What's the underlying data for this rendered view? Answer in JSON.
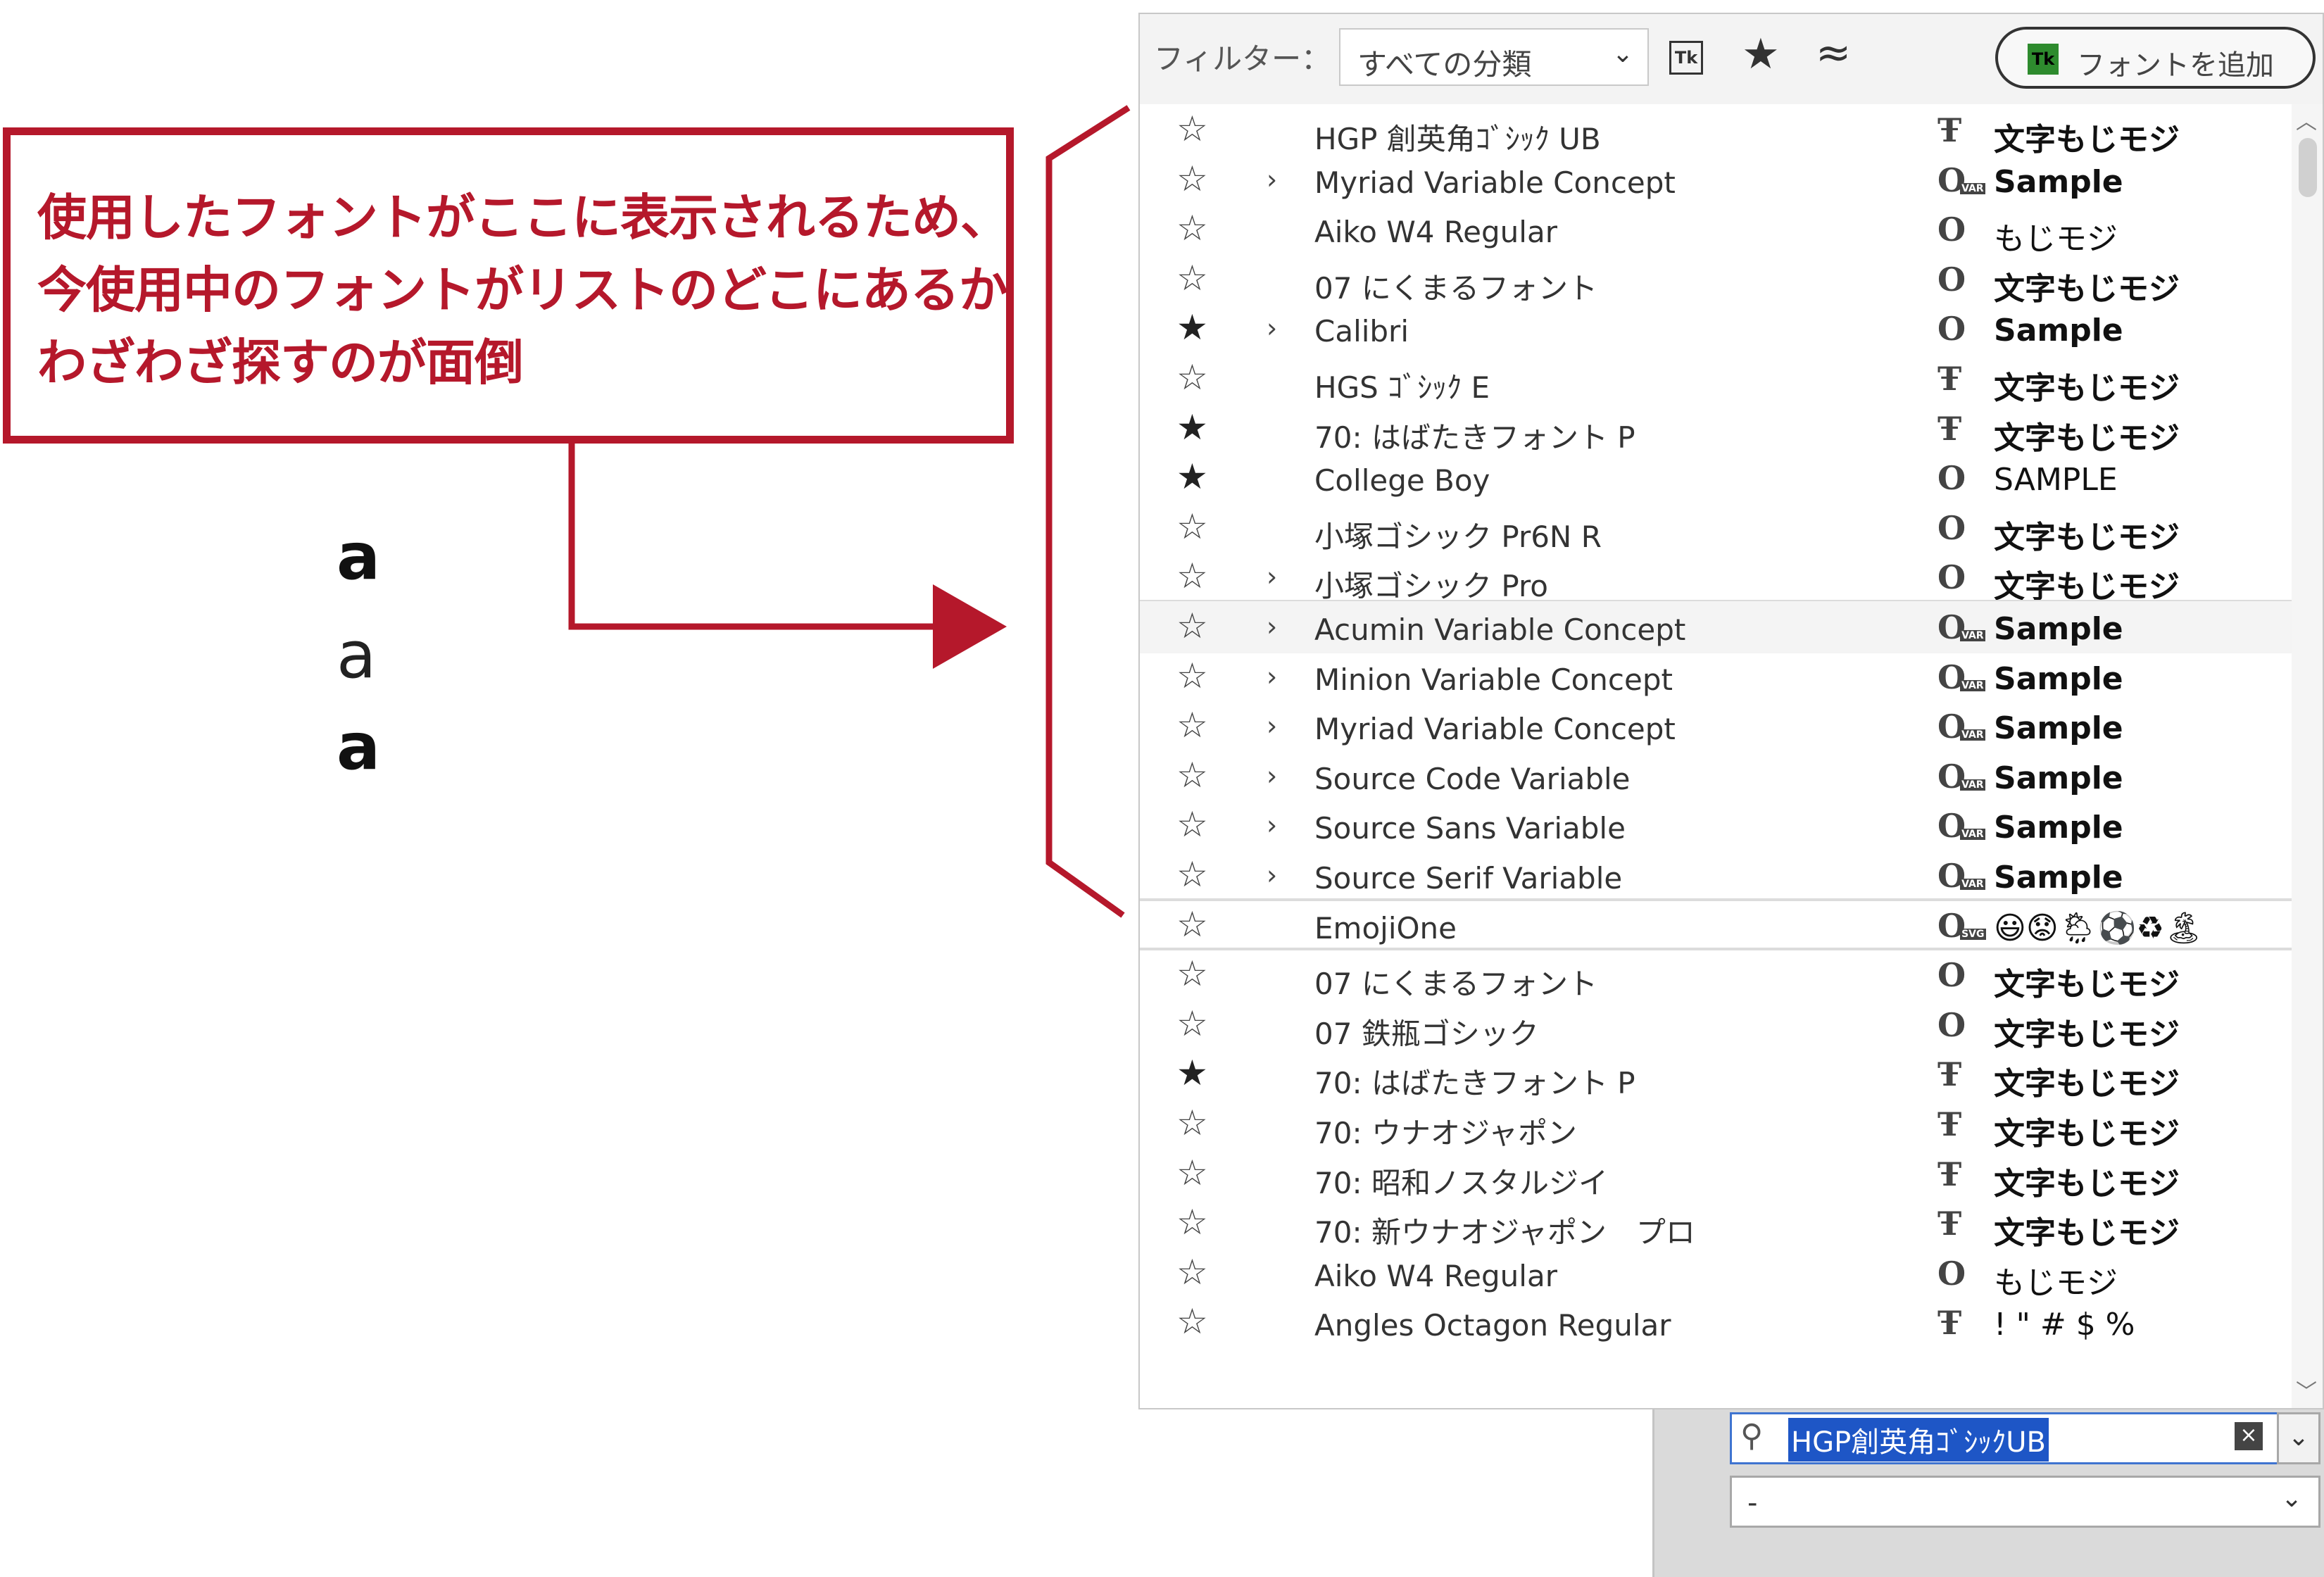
{
  "annotation": {
    "callout_text": "使用したフォントがここに表示されるため、\n今使用中のフォントがリストのどこにあるか\nわざわざ探すのが面倒",
    "glyphs": [
      "a",
      "a",
      "a"
    ],
    "accent_color": "#b5182b"
  },
  "filter_bar": {
    "label": "フィルター：",
    "category_select": "すべての分類",
    "tk_icon": "Tk",
    "favorites_icon": "star-icon",
    "similar_icon": "approx-icon",
    "add_font_label": "フォントを追加",
    "add_font_badge": "Tk"
  },
  "font_list": {
    "recent": [
      {
        "star": "☆",
        "expand": "",
        "name": "HGP 創英角ｺﾞｼｯｸ UB",
        "icon": "Ŧ",
        "sample": "文字もじモジ"
      },
      {
        "star": "☆",
        "expand": "›",
        "name": "Myriad Variable Concept",
        "icon": "O",
        "icon_badge": "var",
        "sample": "Sample"
      },
      {
        "star": "☆",
        "expand": "",
        "name": "Aiko W4 Regular",
        "icon": "O",
        "sample": "もじモジ"
      },
      {
        "star": "☆",
        "expand": "",
        "name": "07 にくまるフォント",
        "icon": "O",
        "sample": "文字もじモジ"
      },
      {
        "star": "★",
        "expand": "›",
        "name": "Calibri",
        "icon": "O",
        "sample": "Sample"
      },
      {
        "star": "☆",
        "expand": "",
        "name": "HGS ｺﾞｼｯｸ E",
        "icon": "Ŧ",
        "sample": "文字もじモジ"
      },
      {
        "star": "★",
        "expand": "",
        "name": "70: はばたきフォント P",
        "icon": "Ŧ",
        "sample": "文字もじモジ"
      },
      {
        "star": "★",
        "expand": "",
        "name": "College Boy",
        "icon": "O",
        "sample": "SAMPLE"
      },
      {
        "star": "☆",
        "expand": "",
        "name": "小塚ゴシック Pr6N R",
        "icon": "O",
        "sample": "文字もじモジ"
      },
      {
        "star": "☆",
        "expand": "›",
        "name": "小塚ゴシック Pro",
        "icon": "O",
        "sample": "文字もじモジ"
      }
    ],
    "variable": [
      {
        "star": "☆",
        "expand": "›",
        "name": "Acumin Variable Concept",
        "icon": "O",
        "icon_badge": "var",
        "sample": "Sample"
      },
      {
        "star": "☆",
        "expand": "›",
        "name": "Minion Variable Concept",
        "icon": "O",
        "icon_badge": "var",
        "sample": "Sample"
      },
      {
        "star": "☆",
        "expand": "›",
        "name": "Myriad Variable Concept",
        "icon": "O",
        "icon_badge": "var",
        "sample": "Sample"
      },
      {
        "star": "☆",
        "expand": "›",
        "name": "Source Code Variable",
        "icon": "O",
        "icon_badge": "var",
        "sample": "Sample"
      },
      {
        "star": "☆",
        "expand": "›",
        "name": "Source Sans Variable",
        "icon": "O",
        "icon_badge": "var",
        "sample": "Sample"
      },
      {
        "star": "☆",
        "expand": "›",
        "name": "Source Serif Variable",
        "icon": "O",
        "icon_badge": "var",
        "sample": "Sample"
      }
    ],
    "svg": [
      {
        "star": "☆",
        "expand": "",
        "name": "EmojiOne",
        "icon": "O",
        "icon_badge": "svg",
        "sample": "😃😟🌦⚽♻🏝"
      }
    ],
    "all": [
      {
        "star": "☆",
        "expand": "",
        "name": "07 にくまるフォント",
        "icon": "O",
        "sample": "文字もじモジ"
      },
      {
        "star": "☆",
        "expand": "",
        "name": "07 鉄瓶ゴシック",
        "icon": "O",
        "sample": "文字もじモジ"
      },
      {
        "star": "★",
        "expand": "",
        "name": "70: はばたきフォント P",
        "icon": "Ŧ",
        "sample": "文字もじモジ"
      },
      {
        "star": "☆",
        "expand": "",
        "name": "70: ウナオジャポン",
        "icon": "Ŧ",
        "sample": "文字もじモジ"
      },
      {
        "star": "☆",
        "expand": "",
        "name": "70: 昭和ノスタルジイ",
        "icon": "Ŧ",
        "sample": "文字もじモジ"
      },
      {
        "star": "☆",
        "expand": "",
        "name": "70: 新ウナオジャポン　プロ",
        "icon": "Ŧ",
        "sample": "文字もじモジ"
      },
      {
        "star": "☆",
        "expand": "",
        "name": "Aiko W4 Regular",
        "icon": "O",
        "sample": "もじモジ"
      },
      {
        "star": "☆",
        "expand": "",
        "name": "Angles Octagon Regular",
        "icon": "Ŧ",
        "sample": "! \" # $ %"
      }
    ],
    "hover_index": 10
  },
  "scrollbar": {
    "up": "︿",
    "down": "﹀"
  },
  "font_search": {
    "value": "HGP創英角ｺﾞｼｯｸUB",
    "clear_icon": "×",
    "dropdown_icon": "⌄"
  },
  "font_style": {
    "value": "-",
    "dropdown_icon": "⌄"
  }
}
